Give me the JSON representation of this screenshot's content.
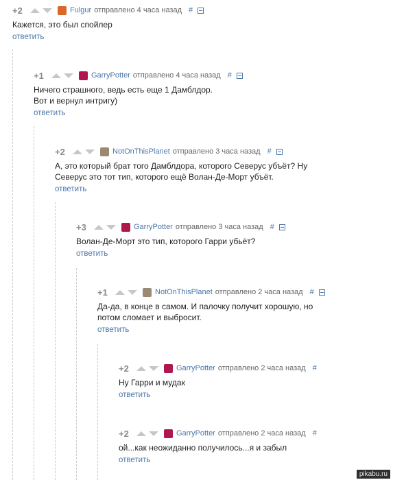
{
  "comments": [
    {
      "rating": "+2",
      "user": "Fulgur",
      "time": "отправлено 4 часа назад",
      "hash": "#",
      "text": "Кажется, это был спойлер",
      "reply": "ответить",
      "avatar_color": "#d9662b"
    },
    {
      "rating": "+1",
      "user": "GarryPotter",
      "time": "отправлено 4 часа назад",
      "hash": "#",
      "text": "Ничего страшного, ведь есть еще 1 Дамблдор.\nВот и вернул интригу)",
      "reply": "ответить",
      "avatar_color": "#b0174f"
    },
    {
      "rating": "+2",
      "user": "NotOnThisPlanet",
      "time": "отправлено 3 часа назад",
      "hash": "#",
      "text": "А, это который брат того Дамблдора, которого Северус убъёт? Ну\nСеверус это тот тип, которого ещё Волан-Де-Морт убъёт.",
      "reply": "ответить",
      "avatar_color": "#9a8a72"
    },
    {
      "rating": "+3",
      "user": "GarryPotter",
      "time": "отправлено 3 часа назад",
      "hash": "#",
      "text": "Волан-Де-Морт это тип, которого Гарри убьёт?",
      "reply": "ответить",
      "avatar_color": "#b0174f"
    },
    {
      "rating": "+1",
      "user": "NotOnThisPlanet",
      "time": "отправлено 2 часа назад",
      "hash": "#",
      "text": "Да-да, в конце в самом. И палочку получит хорошую, но\nпотом сломает и выбросит.",
      "reply": "ответить",
      "avatar_color": "#9a8a72"
    },
    {
      "rating": "+2",
      "user": "GarryPotter",
      "time": "отправлено 2 часа назад",
      "hash": "#",
      "text": "Ну Гарри и мудак",
      "reply": "ответить",
      "avatar_color": "#b0174f"
    },
    {
      "rating": "+2",
      "user": "GarryPotter",
      "time": "отправлено 2 часа назад",
      "hash": "#",
      "text": "ой...как неожиданно получилось...я и забыл",
      "reply": "ответить",
      "avatar_color": "#b0174f"
    }
  ],
  "watermark": "pikabu.ru"
}
